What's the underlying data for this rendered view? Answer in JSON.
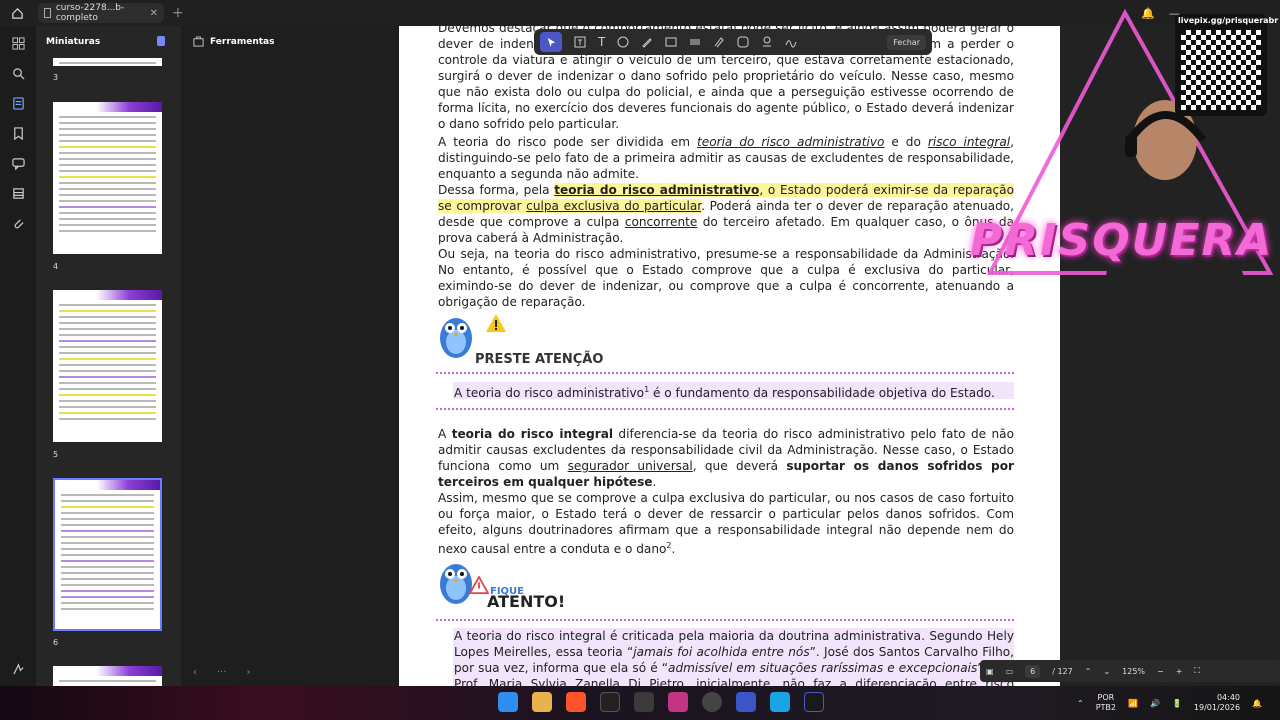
{
  "tabbar": {
    "tab_title": "curso-2278...b-completo"
  },
  "thumbnails_panel": {
    "title": "Miniaturas",
    "page_numbers": [
      "3",
      "4",
      "5",
      "6"
    ]
  },
  "tools_panel": {
    "title": "Ferramentas"
  },
  "annotation_toolbar": {
    "close_label": "Fechar"
  },
  "document": {
    "p1": "Devemos destacar que o comportamento estatal pode ser lícito, e ainda assim poderá gerar o dever de indenizar. Por exemplo, o policial perseguindo bandidos em fuga vem a perder o controle da viatura e atingir o veículo de um terceiro, que estava corretamente estacionado, surgirá o dever de indenizar o dano sofrido pelo proprietário do veículo. Nesse caso, mesmo que não exista dolo ou culpa do policial, e ainda que a perseguição estivesse ocorrendo de forma lícita, no exercício dos deveres funcionais do agente público, o Estado deverá indenizar o dano sofrido pelo particular.",
    "p2_a": "A teoria do risco pode ser dividida em ",
    "p2_b": "teoria do risco administrativo",
    "p2_c": " e do ",
    "p2_d": "risco integral",
    "p2_e": ", distinguindo-se pelo fato de a primeira admitir as causas de excludentes de responsabilidade, enquanto a segunda não admite.",
    "p3_a": "Dessa forma, pela ",
    "p3_b": "teoria do risco administrativo",
    "p3_c": ", o Estado poderá eximir-se da reparação se comprovar ",
    "p3_d": "culpa exclusiva do particular",
    "p3_e": ". Poderá ainda ter o dever de reparação atenuado, desde que comprove a culpa ",
    "p3_f": "concorrente",
    "p3_g": " do terceiro afetado. Em qualquer caso, o ônus da prova caberá à Administração.",
    "p4": "Ou seja, na teoria do risco administrativo, presume-se a responsabilidade da Administração. No entanto, é possível que o Estado comprove que a culpa é exclusiva do particular, eximindo-se do dever de indenizar, ou comprove que a culpa é concorrente, atenuando a obrigação de reparação.",
    "callout1_title": "PRESTE ATENÇÃO",
    "callout1_text_a": "A teoria do risco administrativo",
    "callout1_sup": "1",
    "callout1_text_b": " é o fundamento da responsabilidade objetiva do Estado.",
    "p5_a": "A ",
    "p5_b": "teoria do risco integral",
    "p5_c": " diferencia-se da teoria do risco administrativo pelo fato de não admitir causas excludentes da responsabilidade civil da Administração. Nesse caso, o Estado funciona como um ",
    "p5_d": "segurador universal",
    "p5_e": ", que deverá ",
    "p5_f": "suportar os danos sofridos por terceiros em qualquer hipótese",
    "p5_g": ".",
    "p6_a": "Assim, mesmo que se comprove a culpa exclusiva do particular, ou nos casos de caso fortuito ou força maior, o Estado terá o dever de ressarcir o particular pelos danos sofridos. Com efeito, alguns doutrinadores afirmam que a responsabilidade integral não depende nem do nexo causal entre a conduta e o dano",
    "p6_sup": "2",
    "p6_b": ".",
    "callout2_title_small": "FIQUE",
    "callout2_title_big": "ATENTO!",
    "callout2_a": "A teoria do risco integral é criticada pela maioria da doutrina administrativa. Segundo Hely Lopes Meirelles, essa teoria “",
    "callout2_b": "jamais foi acolhida entre nós",
    "callout2_c": "”. José dos Santos Carvalho Filho, por sua vez, informa que ela só é “",
    "callout2_d": "admissível em situações raríssimas e excepcionais",
    "callout2_e": "”. Já a Prof. Maria Sylvia Zanella Di Pietro, inicialmente, não faz a diferenciação entre risco administrativo e risco integral, mencionando"
  },
  "zoom_bar": {
    "page_current": "6",
    "page_total": "/ 127",
    "zoom": "125%"
  },
  "taskbar": {
    "lang_top": "POR",
    "lang_bottom": "PTB2",
    "time": "04:40",
    "date": "19/01/2026"
  },
  "overlay": {
    "qr_url": "livepix.gg/prisquerabr",
    "brand": "PRISQUERA"
  },
  "colors": {
    "accent": "#4a58c7",
    "highlight_yellow": "#fdf59a",
    "highlight_purple": "#eadbff",
    "brand_pink": "#f36ad6"
  }
}
